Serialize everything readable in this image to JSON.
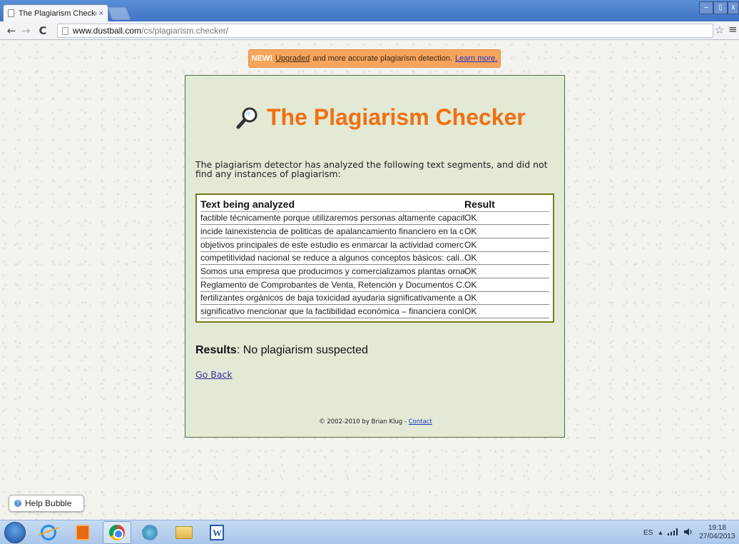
{
  "browser": {
    "tab_title": "The Plagiarism Checker",
    "tab_close": "×",
    "url_host": "www.dustball.com",
    "url_path": "/cs/plagiarism.checker/",
    "back_glyph": "←",
    "forward_glyph": "→",
    "reload_glyph": "C",
    "star_glyph": "☆",
    "menu_glyph": "≡",
    "window_controls": {
      "minimize": "–",
      "maximize": "▯",
      "close": "x"
    }
  },
  "banner": {
    "new_label": "NEW!",
    "upgraded_link": "Upgraded",
    "text": "and more accurate plagiarism detection.",
    "learn_more_link": "Learn more."
  },
  "page": {
    "title": "The Plagiarism Checker",
    "intro": "The plagiarism detector has analyzed the following text segments, and did not find any instances of plagiarism:",
    "table": {
      "headers": [
        "Text being analyzed",
        "Result"
      ],
      "rows": [
        {
          "text": "factible técnicamente porque utilizaremos personas altamente capacit...",
          "result": "OK"
        },
        {
          "text": "incide lainexistencia de politicas de apalancamiento financiero en la c...",
          "result": "OK"
        },
        {
          "text": "objetivos principales de este estudio es enmarcar la actividad comerc...",
          "result": "OK"
        },
        {
          "text": "competitividad nacional se reduce a algunos conceptos básicos: cali...",
          "result": "OK"
        },
        {
          "text": "Somos una empresa que producimos y comercializamos plantas orna...",
          "result": "OK"
        },
        {
          "text": "Reglamento de Comprobantes de Venta, Retención y Documentos C...",
          "result": "OK"
        },
        {
          "text": "fertilizantes orgánicos de baja toxicidad ayudaria significativamente a ...",
          "result": "OK"
        },
        {
          "text": "significativo mencionar que la factibilidad económica – financiera conl...",
          "result": "OK"
        }
      ]
    },
    "results_label": "Results",
    "results_value": ": No plagiarism suspected",
    "go_back": "Go Back",
    "footer_text": "© 2002-2010 by Brian Klug - ",
    "footer_contact": "Contact"
  },
  "help_bubble": {
    "label": "Help Bubble",
    "icon": "help-icon"
  },
  "taskbar": {
    "apps": [
      "start-orb",
      "internet-explorer-icon",
      "media-player-icon",
      "chrome-icon",
      "settings-icon",
      "file-explorer-icon",
      "word-icon"
    ],
    "tray_language": "ES",
    "tray_icons": [
      "▴",
      "signal-icon",
      "speaker-icon"
    ],
    "time": "19:18",
    "date": "27/04/2013"
  },
  "colors": {
    "title_orange": "#f36f10",
    "panel_bg": "#e2ead6",
    "banner_bg": "#f7a45c",
    "link": "#3b2e9a"
  }
}
